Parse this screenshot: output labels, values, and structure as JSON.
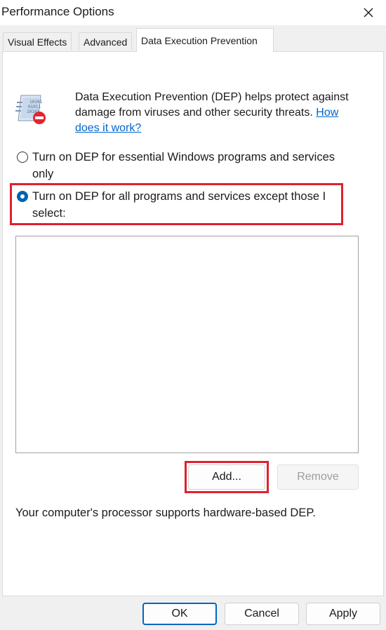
{
  "window": {
    "title": "Performance Options"
  },
  "tabs": [
    {
      "label": "Visual Effects",
      "active": false
    },
    {
      "label": "Advanced",
      "active": false
    },
    {
      "label": "Data Execution Prevention",
      "active": true
    }
  ],
  "intro": {
    "text": "Data Execution Prevention (DEP) helps protect against damage from viruses and other security threats.",
    "link": "How does it work?"
  },
  "options": [
    {
      "label": "Turn on DEP for essential Windows programs and services only",
      "selected": false
    },
    {
      "label": "Turn on DEP for all programs and services except those I select:",
      "selected": true
    }
  ],
  "buttons": {
    "add": "Add...",
    "remove": "Remove",
    "ok": "OK",
    "cancel": "Cancel",
    "apply": "Apply"
  },
  "status": "Your computer's processor supports hardware-based DEP.",
  "colors": {
    "accent": "#0063b1",
    "highlight": "#e0202e",
    "link": "#0066cc"
  }
}
